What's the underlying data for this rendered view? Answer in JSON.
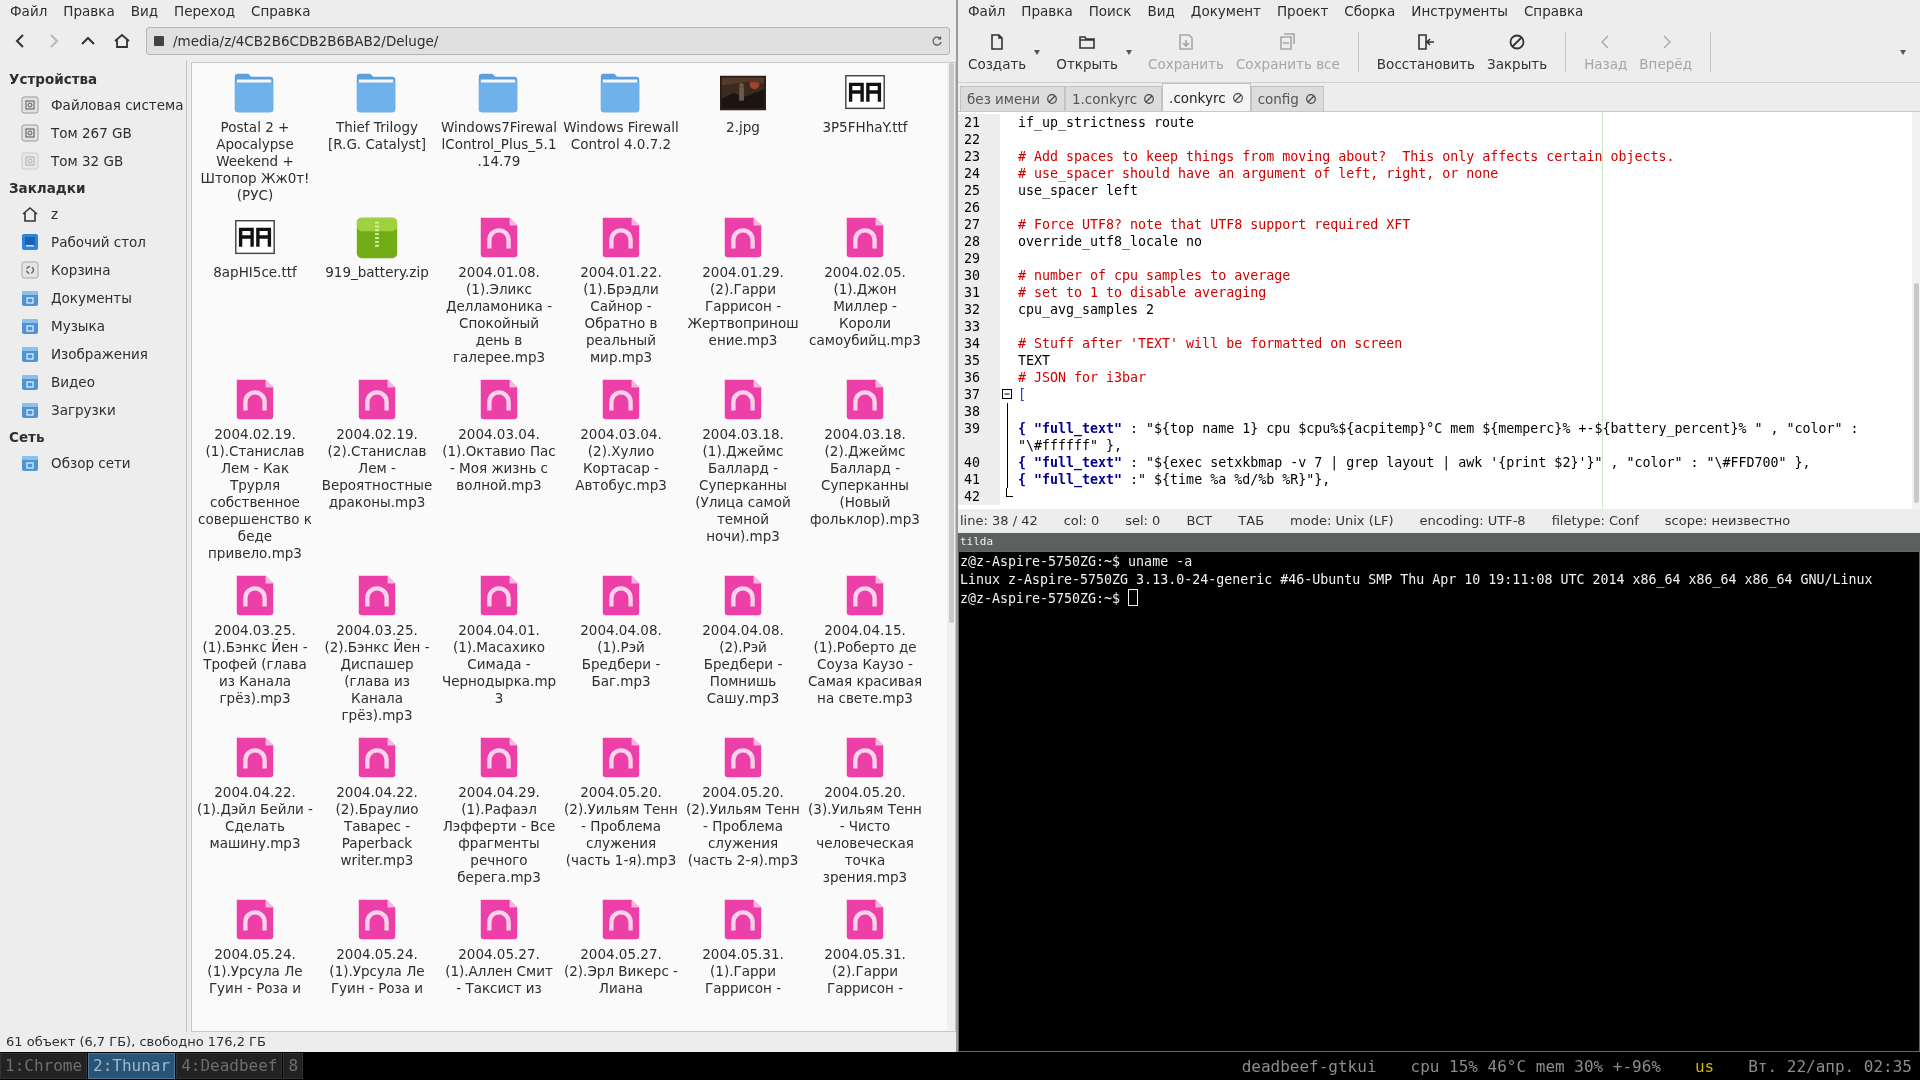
{
  "file_manager": {
    "menu": [
      "Файл",
      "Правка",
      "Вид",
      "Переход",
      "Справка"
    ],
    "nav_buttons": [
      {
        "kind": "back",
        "disabled": false
      },
      {
        "kind": "forward",
        "disabled": true
      },
      {
        "kind": "up",
        "disabled": false
      },
      {
        "kind": "home",
        "disabled": false
      }
    ],
    "path": "/media/z/4CB2B6CDB2B6BAB2/Deluge/",
    "sidebar": [
      {
        "heading": "Устройства",
        "items": [
          {
            "label": "Файловая система",
            "kind": "drive",
            "disabled": false
          },
          {
            "label": "Том 267 GB",
            "kind": "drive",
            "disabled": false
          },
          {
            "label": "Том 32 GB",
            "kind": "drive",
            "disabled": true
          }
        ]
      },
      {
        "heading": "Закладки",
        "items": [
          {
            "label": "z",
            "kind": "home",
            "disabled": false
          },
          {
            "label": "Рабочий стол",
            "kind": "desktop",
            "disabled": false
          },
          {
            "label": "Корзина",
            "kind": "trash",
            "disabled": false
          },
          {
            "label": "Документы",
            "kind": "folder",
            "disabled": false
          },
          {
            "label": "Музыка",
            "kind": "folder",
            "disabled": false
          },
          {
            "label": "Изображения",
            "kind": "folder",
            "disabled": false
          },
          {
            "label": "Видео",
            "kind": "folder",
            "disabled": false
          },
          {
            "label": "Загрузки",
            "kind": "folder",
            "disabled": false
          }
        ]
      },
      {
        "heading": "Сеть",
        "items": [
          {
            "label": "Обзор сети",
            "kind": "folder",
            "disabled": false
          }
        ]
      }
    ],
    "files": [
      {
        "name": "Postal 2 + Apocalypse Weekend + Штопор Жж0т! (РУС)",
        "kind": "folder"
      },
      {
        "name": "Thief Trilogy [R.G. Catalyst]",
        "kind": "folder"
      },
      {
        "name": "Windows7FirewallControl_Plus_5.1.14.79",
        "kind": "folder"
      },
      {
        "name": "Windows Firewall Control 4.0.7.2",
        "kind": "folder"
      },
      {
        "name": "2.jpg"
      },
      {
        "name": "3P5FHhaY.ttf",
        "kind": "font"
      },
      {
        "name": "8apHI5ce.ttf",
        "kind": "font"
      },
      {
        "name": "919_battery.zip",
        "kind": "archive"
      },
      {
        "name": "2004.01.08. (1).Эликс Делламоника - Спокойный день в галерее.mp3",
        "kind": "audio"
      },
      {
        "name": "2004.01.22. (1).Брэдли Сайнор - Обратно в реальный мир.mp3",
        "kind": "audio"
      },
      {
        "name": "2004.01.29. (2).Гарри Гаррисон - Жертвоприношение.mp3",
        "kind": "audio"
      },
      {
        "name": "2004.02.05. (1).Джон Миллер - Короли самоубийц.mp3",
        "kind": "audio"
      },
      {
        "name": "2004.02.19. (1).Станислав Лем - Как Трурля собственное совершенство к беде привело.mp3",
        "kind": "audio"
      },
      {
        "name": "2004.02.19. (2).Станислав Лем - Вероятностные драконы.mp3",
        "kind": "audio"
      },
      {
        "name": "2004.03.04. (1).Октавио Пас - Моя жизнь с волной.mp3",
        "kind": "audio"
      },
      {
        "name": "2004.03.04. (2).Хулио Кортасар - Автобус.mp3",
        "kind": "audio"
      },
      {
        "name": "2004.03.18. (1).Джеймс Баллард - Суперканны (Улица самой темной ночи).mp3",
        "kind": "audio"
      },
      {
        "name": "2004.03.18. (2).Джеймс Баллард - Суперканны (Новый фольклор).mp3",
        "kind": "audio"
      },
      {
        "name": "2004.03.25. (1).Бэнкс Йен - Трофей (глава из Канала грёз).mp3",
        "kind": "audio"
      },
      {
        "name": "2004.03.25. (2).Бэнкс Йен - Диспашер (глава из Канала грёз).mp3",
        "kind": "audio"
      },
      {
        "name": "2004.04.01. (1).Масахико Симада - Чернодырка.mp3",
        "kind": "audio"
      },
      {
        "name": "2004.04.08. (1).Рэй Бредбери - Баг.mp3",
        "kind": "audio"
      },
      {
        "name": "2004.04.08. (2).Рэй Бредбери - Помнишь Сашу.mp3",
        "kind": "audio"
      },
      {
        "name": "2004.04.15. (1).Роберто де Соуза Каузо - Самая красивая на свете.mp3",
        "kind": "audio"
      },
      {
        "name": "2004.04.22. (1).Дэйл Бейли - Сделать машину.mp3",
        "kind": "audio"
      },
      {
        "name": "2004.04.22. (2).Браулио Таварес - Paperback writer.mp3",
        "kind": "audio"
      },
      {
        "name": "2004.04.29. (1).Рафаэл Лэфферти - Все фрагменты речного берега.mp3",
        "kind": "audio"
      },
      {
        "name": "2004.05.20. (2).Уильям Тенн - Проблема служения (часть 1-я).mp3",
        "kind": "audio"
      },
      {
        "name": "2004.05.20. (2).Уильям Тенн - Проблема служения (часть 2-я).mp3",
        "kind": "audio"
      },
      {
        "name": "2004.05.20. (3).Уильям Тенн - Чисто человеческая точка зрения.mp3",
        "kind": "audio"
      },
      {
        "name": "2004.05.24. (1).Урсула Ле Гуин - Роза и",
        "kind": "audio"
      },
      {
        "name": "2004.05.24. (1).Урсула Ле Гуин - Роза и",
        "kind": "audio"
      },
      {
        "name": "2004.05.27. (1).Аллен Смит - Таксист из",
        "kind": "audio"
      },
      {
        "name": "2004.05.27. (2).Эрл Викерс - Лиана",
        "kind": "audio"
      },
      {
        "name": "2004.05.31. (1).Гарри Гаррисон -",
        "kind": "audio"
      },
      {
        "name": "2004.05.31. (2).Гарри Гаррисон -",
        "kind": "audio"
      }
    ],
    "status_bar": "61 объект (6,7 ГБ), свободно 176,2 ГБ"
  },
  "editor": {
    "menu": [
      "Файл",
      "Правка",
      "Поиск",
      "Вид",
      "Документ",
      "Проект",
      "Сборка",
      "Инструменты",
      "Справка"
    ],
    "toolbar": [
      {
        "label": "Создать",
        "kind": "new",
        "disabled": false,
        "dropdown": true
      },
      {
        "label": "Открыть",
        "kind": "open",
        "disabled": false,
        "dropdown": true
      },
      {
        "label": "Сохранить",
        "kind": "save",
        "disabled": true,
        "dropdown": false
      },
      {
        "label": "Сохранить все",
        "kind": "save_all",
        "disabled": true,
        "dropdown": false
      },
      {
        "label": "Восстановить",
        "kind": "revert",
        "disabled": false,
        "dropdown": false
      },
      {
        "label": "Закрыть",
        "kind": "close",
        "disabled": false,
        "dropdown": false
      },
      {
        "label": "Назад",
        "kind": "back",
        "disabled": true,
        "dropdown": false
      },
      {
        "label": "Вперёд",
        "kind": "forward",
        "disabled": true,
        "dropdown": false
      }
    ],
    "tabs": [
      {
        "label": "без имени",
        "selected": false
      },
      {
        "label": "1.conkyrc",
        "selected": false
      },
      {
        "label": ".conkyrc",
        "selected": true
      },
      {
        "label": "config",
        "selected": false
      }
    ],
    "lines": [
      {
        "number": "21",
        "segments": [
          {
            "kind": "plain",
            "text": "if_up_strictness route"
          }
        ]
      },
      {
        "number": "22"
      },
      {
        "number": "23",
        "segments": [
          {
            "kind": "comment",
            "text": "# Add spaces to keep things from moving about?  This only affects certain objects."
          }
        ]
      },
      {
        "number": "24",
        "segments": [
          {
            "kind": "comment",
            "text": "# use_spacer should have an argument of left, right, or none"
          }
        ]
      },
      {
        "number": "25",
        "segments": [
          {
            "kind": "plain",
            "text": "use_spacer left"
          }
        ]
      },
      {
        "number": "26"
      },
      {
        "number": "27",
        "segments": [
          {
            "kind": "comment",
            "text": "# Force UTF8? note that UTF8 support required XFT"
          }
        ]
      },
      {
        "number": "28",
        "segments": [
          {
            "kind": "plain",
            "text": "override_utf8_locale no"
          }
        ]
      },
      {
        "number": "29"
      },
      {
        "number": "30",
        "segments": [
          {
            "kind": "comment",
            "text": "# number of cpu samples to average"
          }
        ]
      },
      {
        "number": "31",
        "segments": [
          {
            "kind": "comment",
            "text": "# set to 1 to disable averaging"
          }
        ]
      },
      {
        "number": "32",
        "segments": [
          {
            "kind": "plain",
            "text": "cpu_avg_samples 2"
          }
        ]
      },
      {
        "number": "33"
      },
      {
        "number": "34",
        "segments": [
          {
            "kind": "comment",
            "text": "# Stuff after 'TEXT' will be formatted on screen"
          }
        ]
      },
      {
        "number": "35",
        "segments": [
          {
            "kind": "plain",
            "text": "TEXT"
          }
        ]
      },
      {
        "number": "36",
        "segments": [
          {
            "kind": "comment",
            "text": "# JSON for i3bar"
          }
        ]
      },
      {
        "number": "37",
        "kind": "fold_start",
        "segments": [
          {
            "kind": "bracket",
            "text": "["
          }
        ]
      },
      {
        "number": "38",
        "kind": "fold_body"
      },
      {
        "number": "39",
        "kind": "fold_body",
        "segments": [
          {
            "kind": "key",
            "text": "{ \"full_text\""
          },
          {
            "kind": "plain",
            "text": " : \"${top name 1} cpu $cpu%${acpitemp}°C mem ${memperc}% +-${battery_percent}% \" , \"color\" : \"\\#ffffff\" },"
          }
        ]
      },
      {
        "number": "40",
        "kind": "fold_body",
        "segments": [
          {
            "kind": "key",
            "text": "{ \"full_text\""
          },
          {
            "kind": "plain",
            "text": " : \"${exec setxkbmap -v 7 | grep layout | awk '{print $2}'}\" , \"color\" : \"\\#FFD700\" },"
          }
        ]
      },
      {
        "number": "41",
        "kind": "fold_body",
        "segments": [
          {
            "kind": "key",
            "text": "{ \"full_text\""
          },
          {
            "kind": "plain",
            "text": " :\" ${time %a %d/%b %R}\"},"
          }
        ]
      },
      {
        "number": "42",
        "kind": "fold_end"
      }
    ],
    "status_bar": [
      "line: 38 / 42",
      "col: 0",
      "sel: 0",
      "ВСТ",
      "ТАБ",
      "mode: Unix (LF)",
      "encoding: UTF-8",
      "filetype: Conf",
      "scope: неизвестно"
    ]
  },
  "terminal": {
    "title": "tilda",
    "lines": [
      "z@z-Aspire-5750ZG:~$ uname -a",
      "Linux z-Aspire-5750ZG 3.13.0-24-generic #46-Ubuntu SMP Thu Apr 10 19:11:08 UTC 2014 x86_64 x86_64 x86_64 GNU/Linux",
      "z@z-Aspire-5750ZG:~$ "
    ],
    "cursor": true
  },
  "taskbar": {
    "workspaces": [
      {
        "label": "1:Chrome",
        "selected": false
      },
      {
        "label": "2:Thunar",
        "selected": true
      },
      {
        "label": "4:Deadbeef",
        "selected": false
      },
      {
        "label": "8",
        "selected": false
      }
    ],
    "status": [
      {
        "text": "deadbeef-gtkui",
        "color": "#8c8c8c"
      },
      {
        "text": "cpu 15% 46°C mem 30% +-96%",
        "color": "#8c8c8c"
      },
      {
        "text": "us",
        "color": "#d4b000"
      },
      {
        "text": "Вт. 22/апр. 02:35",
        "color": "#8c8c8c"
      }
    ]
  }
}
